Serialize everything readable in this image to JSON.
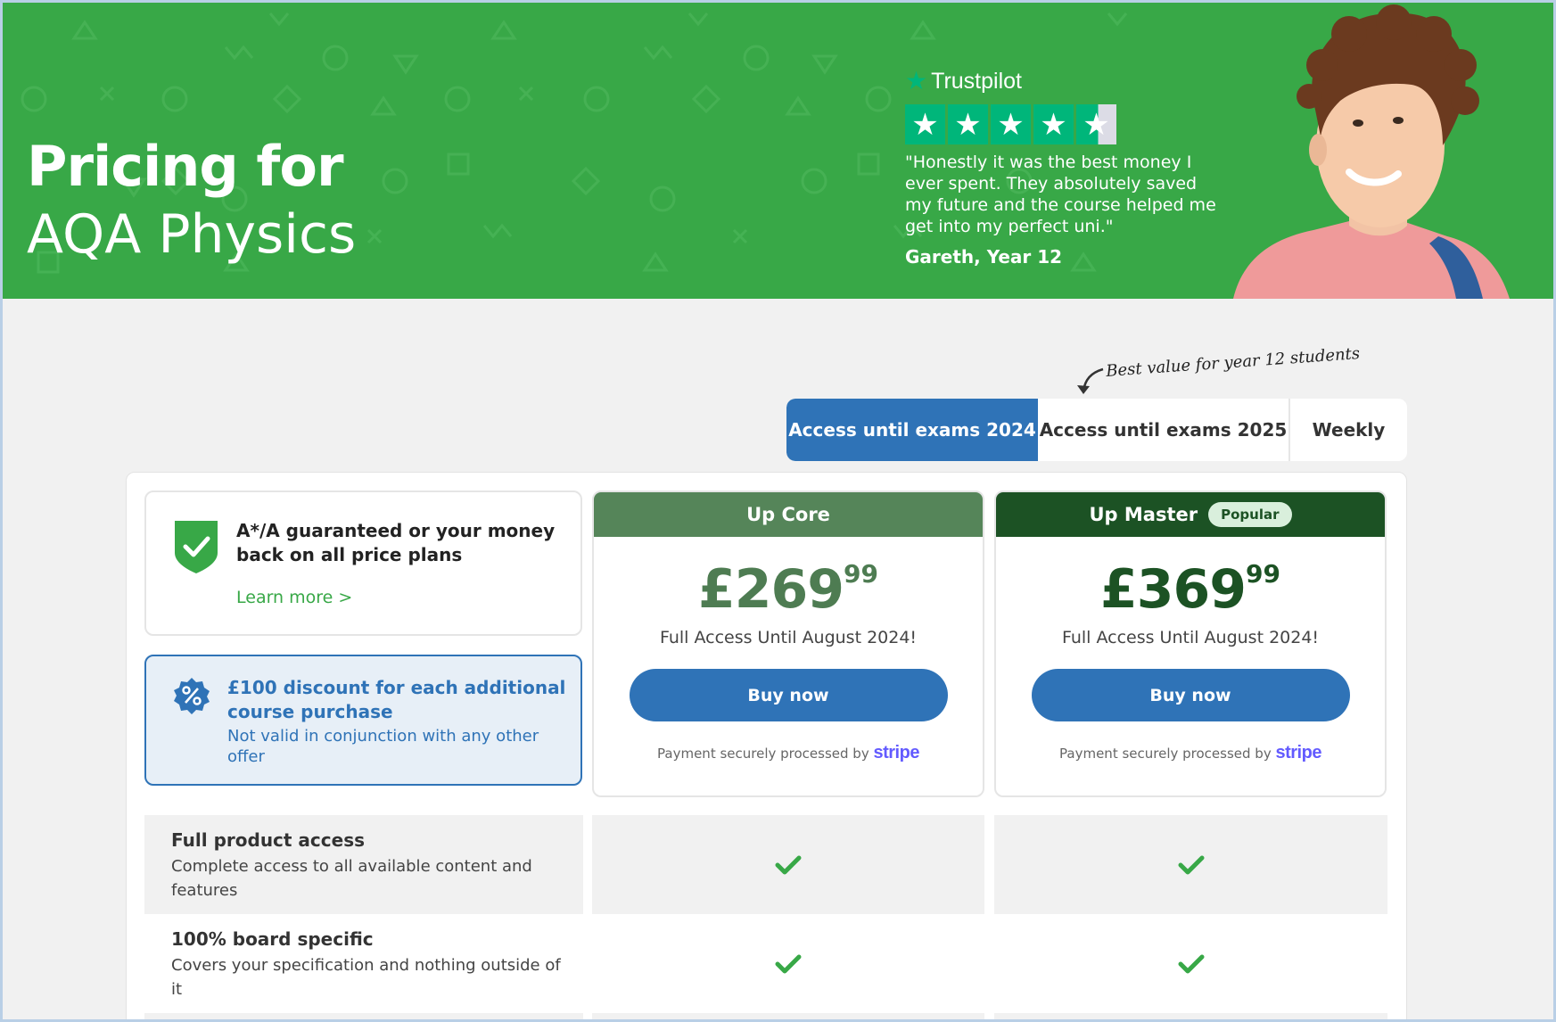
{
  "hero": {
    "title_bold": "Pricing for",
    "title_regular": "AQA Physics",
    "trustpilot": {
      "brand": "Trustpilot",
      "rating": 4.5,
      "quote": "\"Honestly it was the best money I ever spent. They absolutely saved my future and the course helped me get into my perfect uni.\"",
      "author": "Gareth, Year 12"
    }
  },
  "tabs": {
    "annotation": "Best value for year 12 students",
    "items": [
      {
        "label": "Access until exams 2024",
        "active": true
      },
      {
        "label": "Access until exams 2025",
        "active": false
      },
      {
        "label": "Weekly",
        "active": false
      }
    ]
  },
  "guarantee": {
    "title": "A*/A guaranteed or your money back on all price plans",
    "link": "Learn more >"
  },
  "discount": {
    "title": "£100 discount for each additional course purchase",
    "subtitle": "Not valid in conjunction with any other offer"
  },
  "plans": [
    {
      "name": "Up Core",
      "badge": "",
      "price_main": "£269",
      "price_pence": "99",
      "description": "Full Access Until August 2024!",
      "button": "Buy now",
      "secure_text": "Payment securely processed by",
      "processor": "stripe"
    },
    {
      "name": "Up Master",
      "badge": "Popular",
      "price_main": "£369",
      "price_pence": "99",
      "description": "Full Access Until August 2024!",
      "button": "Buy now",
      "secure_text": "Payment securely processed by",
      "processor": "stripe"
    }
  ],
  "features": [
    {
      "title": "Full product access",
      "description": "Complete access to all available content and features",
      "core": true,
      "master": true
    },
    {
      "title": "100% board specific",
      "description": "Covers your specification and nothing outside of it",
      "core": true,
      "master": true
    }
  ],
  "colors": {
    "hero_green": "#38a847",
    "primary_blue": "#2f73b7",
    "core_green": "#558559",
    "master_green": "#1c5224",
    "trustpilot_green": "#00b67a"
  }
}
